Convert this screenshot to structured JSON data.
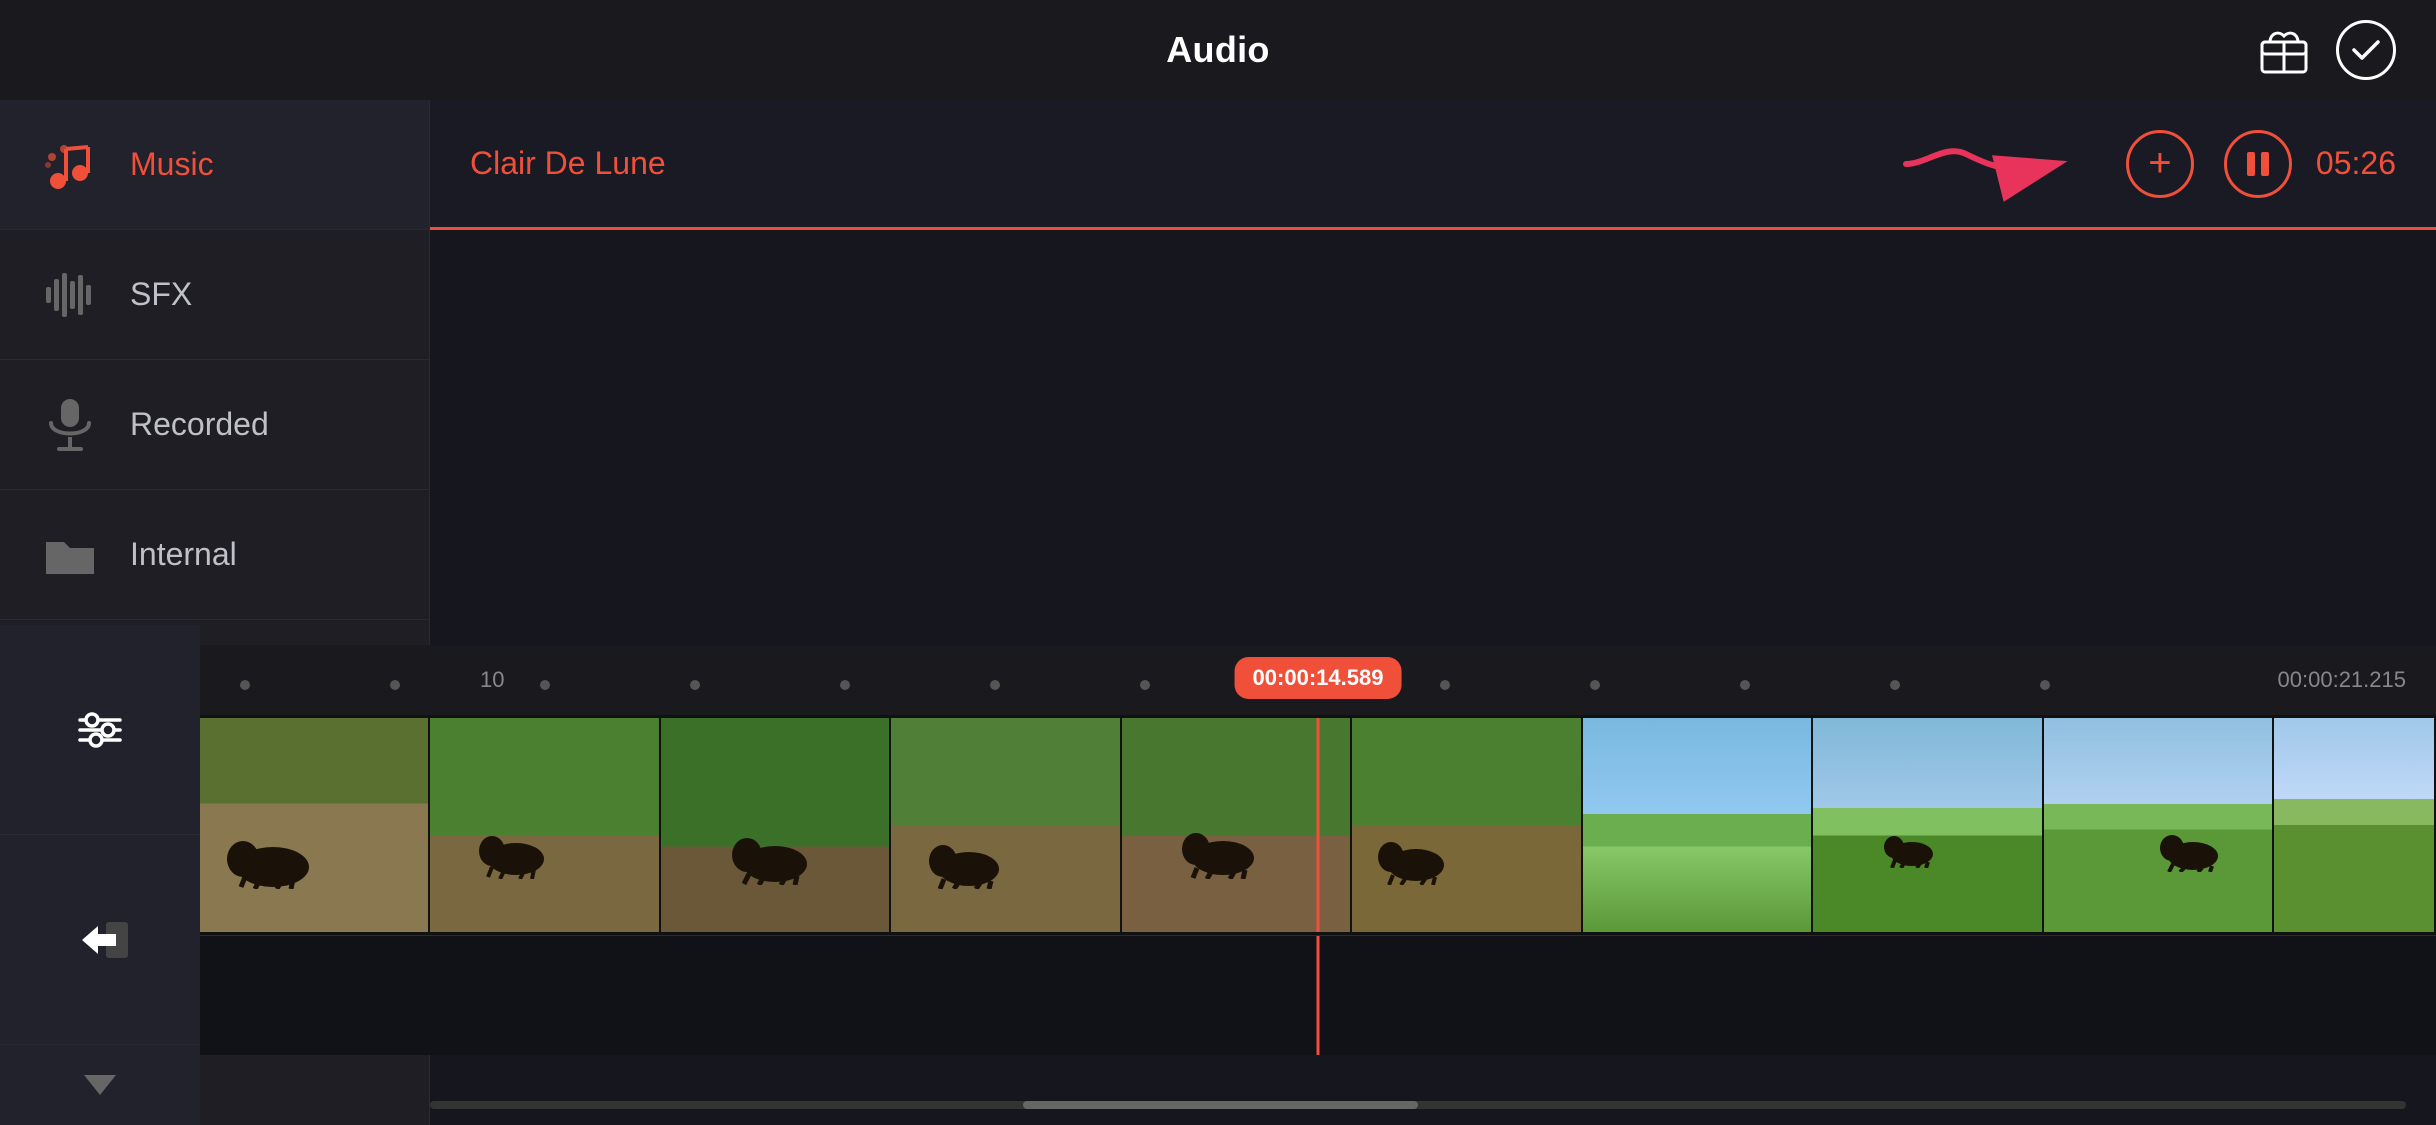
{
  "header": {
    "title": "Audio",
    "store_label": "store",
    "done_label": "done"
  },
  "sidebar": {
    "items": [
      {
        "id": "music",
        "label": "Music",
        "icon": "music-icon",
        "active": true
      },
      {
        "id": "sfx",
        "label": "SFX",
        "icon": "sfx-icon",
        "active": false
      },
      {
        "id": "recorded",
        "label": "Recorded",
        "icon": "mic-icon",
        "active": false
      },
      {
        "id": "internal",
        "label": "Internal",
        "icon": "folder-icon",
        "active": false
      }
    ]
  },
  "content": {
    "selected_track": "Clair De Lune",
    "add_button_label": "+",
    "pause_button_label": "pause",
    "duration": "05:26"
  },
  "timeline": {
    "current_time": "00:00:14.589",
    "end_time": "00:00:21.215",
    "ruler_label_10": "10"
  },
  "tools": {
    "adjust_label": "adjust",
    "export_label": "export"
  },
  "colors": {
    "accent": "#f0503a",
    "bg_dark": "#1a1a1e",
    "sidebar_bg": "#1e1e24",
    "text_primary": "#ffffff",
    "text_muted": "#888888"
  }
}
